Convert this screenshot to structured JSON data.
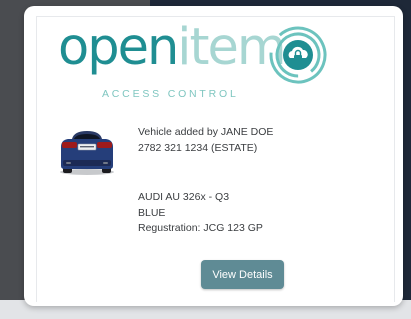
{
  "brand": {
    "word_part1": "open",
    "word_part2": "item",
    "tagline": "ACCESS CONTROL",
    "logo_icon": "cloud-lock-icon",
    "primary_color": "#1f8e92",
    "light_color": "#a7d6d2"
  },
  "vehicle": {
    "image_icon": "car-rear-icon",
    "added_by": "Vehicle added by JANE DOE",
    "phone": "2782 321 1234 (ESTATE)",
    "model": "AUDI AU 326x - Q3",
    "color": "BLUE",
    "registration": "Regustration: JCG 123 GP"
  },
  "actions": {
    "view_details_label": "View Details",
    "button_color": "#5f8b95"
  }
}
